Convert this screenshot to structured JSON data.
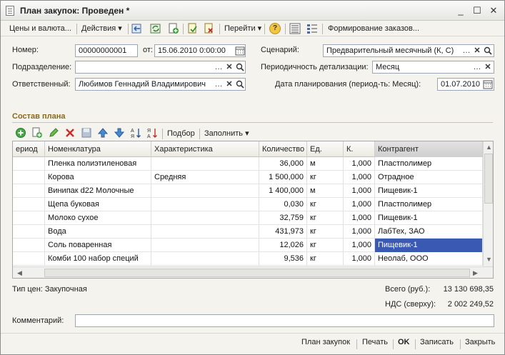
{
  "window": {
    "title": "План закупок: Проведен *",
    "minimize": "_",
    "maximize": "☐",
    "close": "✕"
  },
  "toolbar": {
    "prices": "Цены и валюта...",
    "actions": "Действия",
    "goto": "Перейти",
    "help": "?",
    "form_orders": "Формирование заказов..."
  },
  "header": {
    "number_label": "Номер:",
    "number_value": "00000000001",
    "from_label": "от:",
    "date_value": "15.06.2010  0:00:00",
    "scenario_label": "Сценарий:",
    "scenario_value": "Предварительный месячный (К, С)",
    "department_label": "Подразделение:",
    "department_value": "",
    "period_label": "Периодичность детализации:",
    "period_value": "Месяц",
    "responsible_label": "Ответственный:",
    "responsible_value": "Любимов Геннадий Владимирович",
    "plan_date_label": "Дата планирования (период-ть: Месяц):",
    "plan_date_value": "01.07.2010"
  },
  "section": {
    "title": "Состав плана"
  },
  "table_toolbar": {
    "pick": "Подбор",
    "fill": "Заполнить"
  },
  "table": {
    "columns": [
      "ериод",
      "Номенклатура",
      "Характеристика",
      "Количество",
      "Ед.",
      "К.",
      "Контрагент"
    ],
    "rows": [
      [
        "",
        "Пленка полиэтиленовая",
        "",
        "36,000",
        "м",
        "1,000",
        "Пластполимер"
      ],
      [
        "",
        "Корова",
        "Средняя",
        "1 500,000",
        "кг",
        "1,000",
        "Отрадное"
      ],
      [
        "",
        "Винипак d22 Молочные",
        "",
        "1 400,000",
        "м",
        "1,000",
        "Пищевик-1"
      ],
      [
        "",
        "Щепа буковая",
        "",
        "0,030",
        "кг",
        "1,000",
        "Пластполимер"
      ],
      [
        "",
        "Молоко сухое",
        "",
        "32,759",
        "кг",
        "1,000",
        "Пищевик-1"
      ],
      [
        "",
        "Вода",
        "",
        "431,973",
        "кг",
        "1,000",
        "ЛабТех, ЗАО"
      ],
      [
        "",
        "Соль поваренная",
        "",
        "12,026",
        "кг",
        "1,000",
        "Пищевик-1"
      ],
      [
        "",
        "Комби 100 набор специй",
        "",
        "9,536",
        "кг",
        "1,000",
        "Неолаб, ООО"
      ]
    ],
    "selected_row": 6
  },
  "footer": {
    "price_type": "Тип цен: Закупочная",
    "total_label": "Всего (руб.):",
    "total_value": "13 130 698,35",
    "vat_label": "НДС (сверху):",
    "vat_value": "2 002 249,52",
    "comment_label": "Комментарий:",
    "comment_value": ""
  },
  "bottom_buttons": {
    "plan": "План закупок",
    "print": "Печать",
    "ok": "OK",
    "save": "Записать",
    "close": "Закрыть"
  },
  "colors": {
    "selection": "#3a59b3",
    "section_title": "#8a6a1a"
  }
}
